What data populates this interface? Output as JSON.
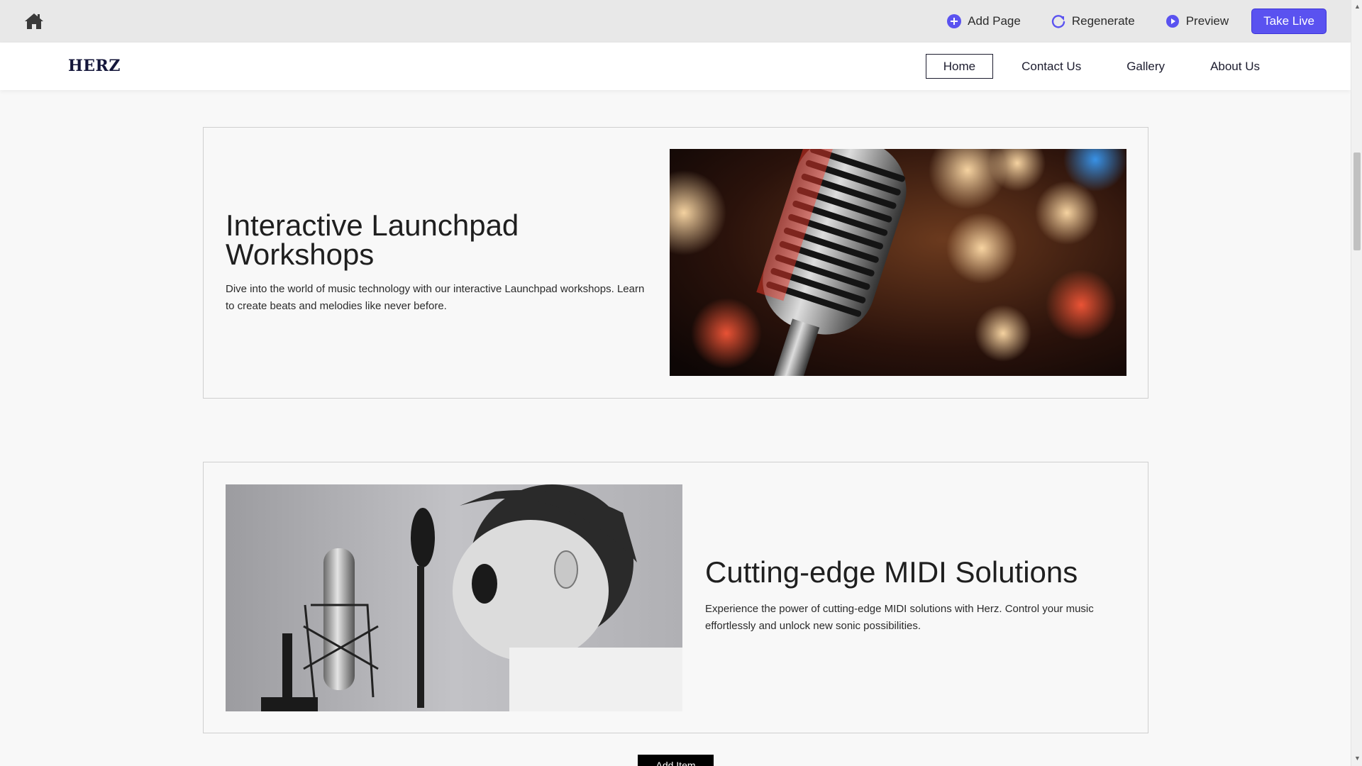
{
  "toolbar": {
    "home_icon": "home-icon",
    "add_page_label": "Add Page",
    "regenerate_label": "Regenerate",
    "preview_label": "Preview",
    "take_live_label": "Take Live",
    "accent_color": "#5a52f0"
  },
  "site": {
    "brand": "HERZ",
    "nav": [
      {
        "label": "Home",
        "active": true
      },
      {
        "label": "Contact Us",
        "active": false
      },
      {
        "label": "Gallery",
        "active": false
      },
      {
        "label": "About Us",
        "active": false
      }
    ]
  },
  "sections": [
    {
      "title": "Interactive Launchpad Workshops",
      "description": "Dive into the world of music technology with our interactive Launchpad workshops. Learn to create beats and melodies like never before.",
      "image": "vintage-microphone-bokeh-photo"
    },
    {
      "title": "Cutting-edge MIDI Solutions",
      "description": "Experience the power of cutting-edge MIDI solutions with Herz. Control your music effortlessly and unlock new sonic possibilities.",
      "image": "boy-shouting-at-studio-microphone-photo"
    }
  ],
  "add_item_label": "Add Item"
}
